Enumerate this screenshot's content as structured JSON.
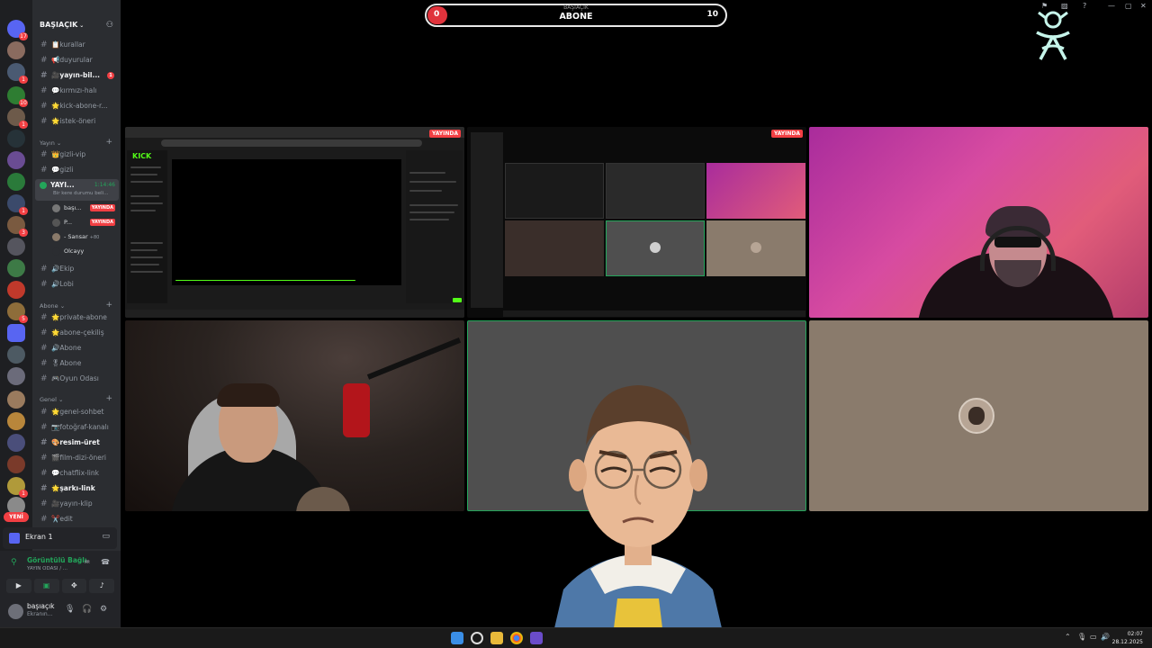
{
  "server": {
    "name": "BAŞIAÇIK"
  },
  "server_rail": {
    "badges": [
      "17",
      "1",
      "10",
      "1",
      "1",
      "3",
      "5",
      "1"
    ],
    "new_label": "YENİ"
  },
  "channels_top": [
    {
      "label": "kurallar",
      "emoji": "📋",
      "bold": false
    },
    {
      "label": "duyurular",
      "emoji": "📢",
      "bold": false
    },
    {
      "label": "yayın-bil...",
      "emoji": "🎥",
      "bold": true,
      "mention": "1"
    },
    {
      "label": "kırmızı-halı",
      "emoji": "💬",
      "bold": false
    },
    {
      "label": "kick-abone-r...",
      "emoji": "🌟",
      "bold": false
    },
    {
      "label": "istek-öneri",
      "emoji": "🌟",
      "bold": false
    }
  ],
  "category_yayin": {
    "label": "Yayın",
    "channels": [
      {
        "label": "gizli-vip",
        "emoji": "👑"
      },
      {
        "label": "gizli",
        "emoji": "💬"
      }
    ]
  },
  "voice_channel": {
    "name": "YAYI...",
    "time": "1:14:46",
    "status": "Bir kere durumu beli...",
    "users": [
      {
        "name": "başı...",
        "live": "YAYINDA"
      },
      {
        "name": "P...",
        "live": "YAYINDA"
      },
      {
        "name": "- Sansar",
        "extra": "+80"
      },
      {
        "name": "Olcayy"
      }
    ]
  },
  "voice_other": [
    {
      "label": "Ekip",
      "emoji": "🔊"
    },
    {
      "label": "Lobi",
      "emoji": "🔊"
    }
  ],
  "category_abone": {
    "label": "Abone",
    "channels": [
      {
        "label": "private-abone",
        "emoji": "🌟"
      },
      {
        "label": "abone-çekiliş",
        "emoji": "🌟"
      },
      {
        "label": "Abone",
        "emoji": "🔊"
      },
      {
        "label": "Abone",
        "emoji": "🎖"
      },
      {
        "label": "Oyun Odası",
        "emoji": "🎮"
      }
    ]
  },
  "category_genel": {
    "label": "Genel",
    "channels": [
      {
        "label": "genel-sohbet",
        "emoji": "🌟",
        "bold": false
      },
      {
        "label": "fotoğraf-kanalı",
        "emoji": "📷",
        "bold": false
      },
      {
        "label": "resim-üret",
        "emoji": "🎨",
        "bold": true
      },
      {
        "label": "film-dizi-öneri",
        "emoji": "🎬",
        "bold": false
      },
      {
        "label": "chatflix-link",
        "emoji": "💬",
        "bold": false
      },
      {
        "label": "şarkı-link",
        "emoji": "🌟",
        "bold": true
      },
      {
        "label": "yayın-klip",
        "emoji": "🎥",
        "bold": false
      },
      {
        "label": "edit",
        "emoji": "✂️",
        "bold": false
      }
    ]
  },
  "screen_panel": {
    "label": "Ekran 1"
  },
  "rtc": {
    "status": "Görüntülü Bağlı",
    "channel": "YAYIN ODASI / ..."
  },
  "user_panel": {
    "name": "başıaçık",
    "status": "Ekranın..."
  },
  "goal": {
    "sub": "BAŞIAÇIK",
    "label": "ABONE",
    "current": "0",
    "max": "10",
    "progress": 0.0
  },
  "tiles": {
    "live_tag": "YAYINDA",
    "site_logo": "KICK"
  },
  "taskbar": {
    "time": "02:07",
    "date": "28.12.2025"
  },
  "colors": {
    "accent_red": "#f23f43",
    "live_green": "#23a55a",
    "brand_green": "#53fc18",
    "logo_teal": "#c6f5ea"
  }
}
